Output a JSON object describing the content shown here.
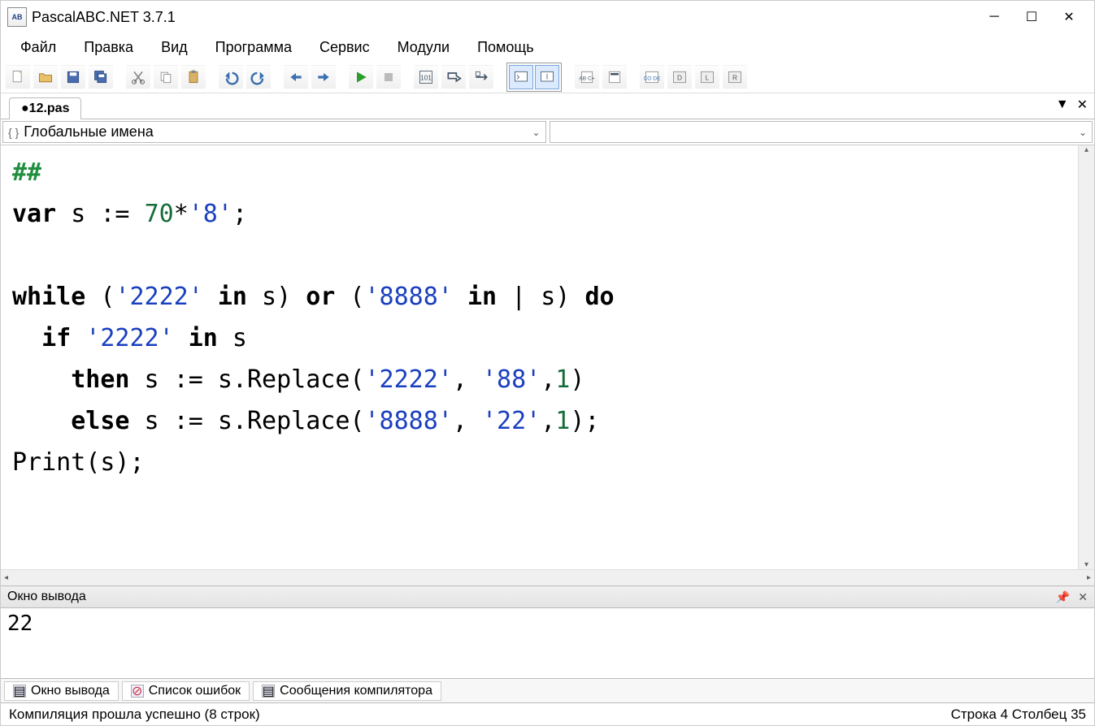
{
  "window": {
    "title": "PascalABC.NET 3.7.1",
    "app_icon_text": "AB"
  },
  "menu": {
    "items": [
      "Файл",
      "Правка",
      "Вид",
      "Программа",
      "Сервис",
      "Модули",
      "Помощь"
    ]
  },
  "tab": {
    "label": "●12.pas"
  },
  "scope_combo": {
    "left_label": "Глобальные имена",
    "right_label": ""
  },
  "code": {
    "line1_cmt": "##",
    "line2_a": "var",
    "line2_b": " s := ",
    "line2_num": "70",
    "line2_c": "*",
    "line2_str": "'8'",
    "line2_d": ";",
    "line4_a": "while",
    "line4_b": " (",
    "line4_s1": "'2222'",
    "line4_c": " ",
    "line4_kw_in1": "in",
    "line4_d": " s) ",
    "line4_kw_or": "or",
    "line4_e": " (",
    "line4_s2": "'8888'",
    "line4_f": " ",
    "line4_kw_in2": "in",
    "line4_g": " | s) ",
    "line4_kw_do": "do",
    "line5_a": "  ",
    "line5_kw_if": "if",
    "line5_b": " ",
    "line5_s": "'2222'",
    "line5_c": " ",
    "line5_kw_in": "in",
    "line5_d": " s",
    "line6_a": "    ",
    "line6_kw_then": "then",
    "line6_b": " s := s.Replace(",
    "line6_s1": "'2222'",
    "line6_c": ", ",
    "line6_s2": "'88'",
    "line6_d": ",",
    "line6_n": "1",
    "line6_e": ")",
    "line7_a": "    ",
    "line7_kw_else": "else",
    "line7_b": " s := s.Replace(",
    "line7_s1": "'8888'",
    "line7_c": ", ",
    "line7_s2": "'22'",
    "line7_d": ",",
    "line7_n": "1",
    "line7_e": ");",
    "line8": "Print(s);"
  },
  "output": {
    "header": "Окно вывода",
    "text": "22"
  },
  "bottom_tabs": {
    "t1": "Окно вывода",
    "t2": "Список ошибок",
    "t3": "Сообщения компилятора"
  },
  "status": {
    "left": "Компиляция прошла успешно (8 строк)",
    "right": "Строка 4 Столбец 35"
  }
}
